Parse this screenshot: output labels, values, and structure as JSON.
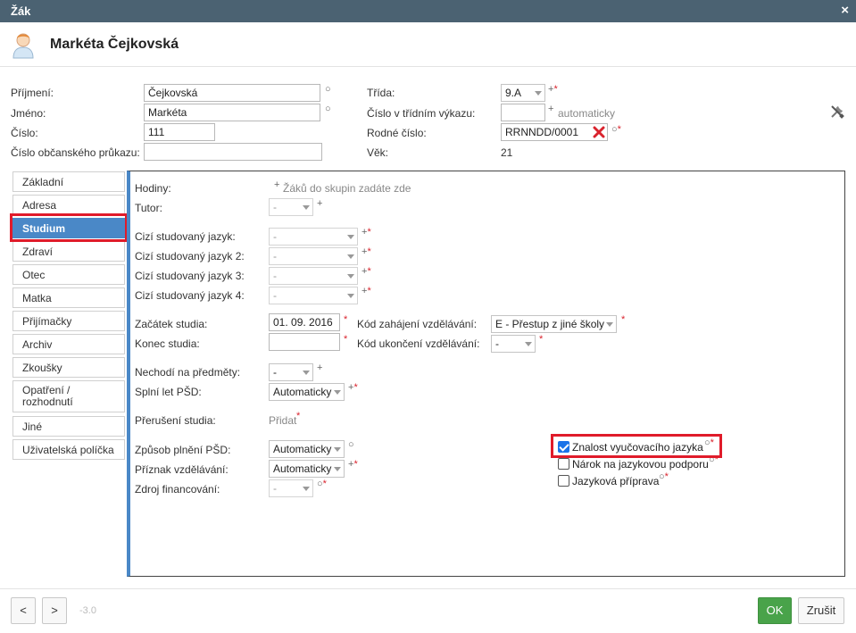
{
  "window": {
    "title": "Žák",
    "close_icon": "×"
  },
  "header": {
    "student_name": "Markéta Čejkovská"
  },
  "top_form": {
    "prijmeni": {
      "label": "Příjmení:",
      "value": "Čejkovská"
    },
    "jmeno": {
      "label": "Jméno:",
      "value": "Markéta"
    },
    "cislo": {
      "label": "Číslo:",
      "value": "111"
    },
    "op": {
      "label": "Číslo občanského průkazu:",
      "value": ""
    },
    "trida": {
      "label": "Třída:",
      "value": "9.A"
    },
    "vykaz": {
      "label": "Číslo v třídním výkazu:",
      "value": "",
      "hint": "automaticky"
    },
    "rodne": {
      "label": "Rodné číslo:",
      "value": "RRNNDD/0001"
    },
    "vek": {
      "label": "Věk:",
      "value": "21"
    }
  },
  "tabs": [
    {
      "label": "Základní"
    },
    {
      "label": "Adresa"
    },
    {
      "label": "Studium"
    },
    {
      "label": "Zdraví"
    },
    {
      "label": "Otec"
    },
    {
      "label": "Matka"
    },
    {
      "label": "Přijímačky"
    },
    {
      "label": "Archiv"
    },
    {
      "label": "Zkoušky"
    },
    {
      "label": "Opatření / rozhodnutí"
    },
    {
      "label": "Jiné"
    },
    {
      "label": "Uživatelská políčka"
    }
  ],
  "studium": {
    "hodiny": {
      "label": "Hodiny:",
      "value": "Žáků do skupin zadáte zde"
    },
    "tutor": {
      "label": "Tutor:",
      "value": "-"
    },
    "jazyk1": {
      "label": "Cizí studovaný jazyk:",
      "value": "-"
    },
    "jazyk2": {
      "label": "Cizí studovaný jazyk 2:",
      "value": "-"
    },
    "jazyk3": {
      "label": "Cizí studovaný jazyk 3:",
      "value": "-"
    },
    "jazyk4": {
      "label": "Cizí studovaný jazyk 4:",
      "value": "-"
    },
    "zacatek": {
      "label": "Začátek studia:",
      "value": "01. 09. 2016"
    },
    "konec": {
      "label": "Konec studia:",
      "value": ""
    },
    "kod_zahajeni": {
      "label": "Kód zahájení vzdělávání:",
      "value": "E - Přestup z jiné školy"
    },
    "kod_ukonceni": {
      "label": "Kód ukončení vzdělávání:",
      "value": "-"
    },
    "nechodi": {
      "label": "Nechodí na předměty:",
      "value": "-"
    },
    "splni": {
      "label": "Splní let PŠD:",
      "value": "Automaticky"
    },
    "preruseni": {
      "label": "Přerušení studia:",
      "value": "Přidat"
    },
    "zpusob": {
      "label": "Způsob plnění PŠD:",
      "value": "Automaticky"
    },
    "priznak": {
      "label": "Příznak vzdělávání:",
      "value": "Automaticky"
    },
    "zdroj": {
      "label": "Zdroj financování:",
      "value": "-"
    },
    "znalost": {
      "label": "Znalost vyučovacího jazyka",
      "checked": true
    },
    "narok": {
      "label": "Nárok na jazykovou podporu",
      "checked": false
    },
    "priprava": {
      "label": "Jazyková příprava",
      "checked": false
    }
  },
  "markers": {
    "plus": "+",
    "star": "*",
    "circle": "○"
  },
  "footer": {
    "prev": "<",
    "next": ">",
    "version": "-3.0",
    "ok": "OK",
    "cancel": "Zrušit"
  },
  "colors": {
    "titlebar": "#4b6272",
    "accent": "#4a88c7",
    "ok": "#49a34a",
    "required": "#d9232d",
    "highlight": "#e01b2a"
  }
}
